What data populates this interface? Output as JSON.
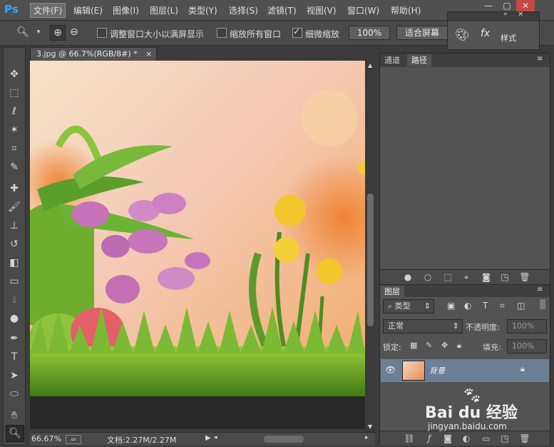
{
  "app": {
    "logo": "Ps"
  },
  "menu": [
    "文件(F)",
    "编辑(E)",
    "图像(I)",
    "图层(L)",
    "类型(Y)",
    "选择(S)",
    "滤镜(T)",
    "视图(V)",
    "窗口(W)",
    "帮助(H)"
  ],
  "window_buttons": [
    "—",
    "▢",
    "✕"
  ],
  "options": {
    "resize_windows_label": "调整窗口大小以满屏显示",
    "zoom_all_label": "缩放所有窗口",
    "scrubby_zoom_label": "细微缩放",
    "scrubby_zoom_checked": true,
    "zoom_value": "100%",
    "fit_screen_label": "适合屏幕"
  },
  "float_panel": {
    "styles_label": "样式",
    "fx_label": "fx"
  },
  "document": {
    "tab_title": "3.jpg @ 66.7%(RGB/8#) *",
    "zoom_readout": "66.67%",
    "doc_size": "文档:2.27M/2.27M"
  },
  "paths_panel": {
    "tabs": [
      "通道",
      "路径"
    ],
    "active_tab": "路径"
  },
  "layers_panel": {
    "title": "图层",
    "filter_kind": "类型",
    "blend_mode": "正常",
    "opacity_label": "不透明度:",
    "opacity_value": "100%",
    "lock_label": "锁定:",
    "fill_label": "填充:",
    "fill_value": "100%",
    "layer_name": "背景"
  },
  "watermark": {
    "brand": "Bai du 经验",
    "url": "jingyan.baidu.com"
  },
  "colors": {
    "accent": "#31a8ff",
    "selected_layer": "#6b7f96"
  }
}
